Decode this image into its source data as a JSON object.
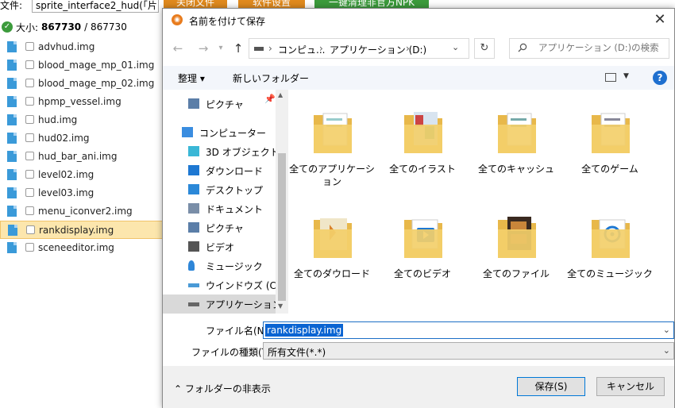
{
  "background_app": {
    "file_label": "文件:",
    "file_value": "sprite_interface2_hud(「片",
    "buttons": [
      "关闭文件",
      "软件设置",
      "一键清理非官方NPK"
    ],
    "size_label": "大小:",
    "size_value": "867730",
    "size_total": "/ 867730",
    "files": [
      "advhud.img",
      "blood_mage_mp_01.img",
      "blood_mage_mp_02.img",
      "hpmp_vessel.img",
      "hud.img",
      "hud02.img",
      "hud_bar_ani.img",
      "level02.img",
      "level03.img",
      "menu_iconver2.img",
      "rankdisplay.img",
      "sceneeditor.img"
    ],
    "selected_file": "rankdisplay.img"
  },
  "dialog": {
    "title": "名前を付けて保存",
    "close": "✕",
    "address": {
      "sep": "›",
      "pc": "コンピュ...",
      "app": "アプリケーション (D:)"
    },
    "search_placeholder": "アプリケーション (D:)の検索",
    "toolbar": {
      "organize": "整理 ▾",
      "new_folder": "新しいフォルダー",
      "help": "?"
    },
    "nav_items": [
      {
        "label": "ピクチャ",
        "icon": "pictures-icon"
      },
      {
        "label": "コンピューター",
        "icon": "computer-icon"
      },
      {
        "label": "3D オブジェクト",
        "icon": "3d-objects-icon"
      },
      {
        "label": "ダウンロード",
        "icon": "downloads-icon"
      },
      {
        "label": "デスクトップ",
        "icon": "desktop-icon"
      },
      {
        "label": "ドキュメント",
        "icon": "documents-icon"
      },
      {
        "label": "ピクチャ",
        "icon": "pictures-icon"
      },
      {
        "label": "ビデオ",
        "icon": "videos-icon"
      },
      {
        "label": "ミュージック",
        "icon": "music-icon"
      },
      {
        "label": "ウインドウズ (C:)",
        "icon": "drive-c-icon"
      },
      {
        "label": "アプリケーション (D:",
        "icon": "drive-d-icon"
      }
    ],
    "folders": [
      "全てのアプリケーション",
      "全てのイラスト",
      "全てのキャッシュ",
      "全てのゲーム",
      "全てのダウロード",
      "全てのビデオ",
      "全てのファイル",
      "全てのミュージック"
    ],
    "filename_label": "ファイル名(N):",
    "filename_value": "rankdisplay.img",
    "filetype_label": "ファイルの種類(T):",
    "filetype_value": "所有文件(*.*)",
    "hide_folders": "フォルダーの非表示",
    "save_button": "保存(S)",
    "cancel_button": "キャンセル"
  },
  "colors": {
    "orange_button": "#e08a1e",
    "green_button": "#3c9b3c",
    "selection_blue": "#0a64d2",
    "folder_yellow": "#f3cf6a"
  }
}
